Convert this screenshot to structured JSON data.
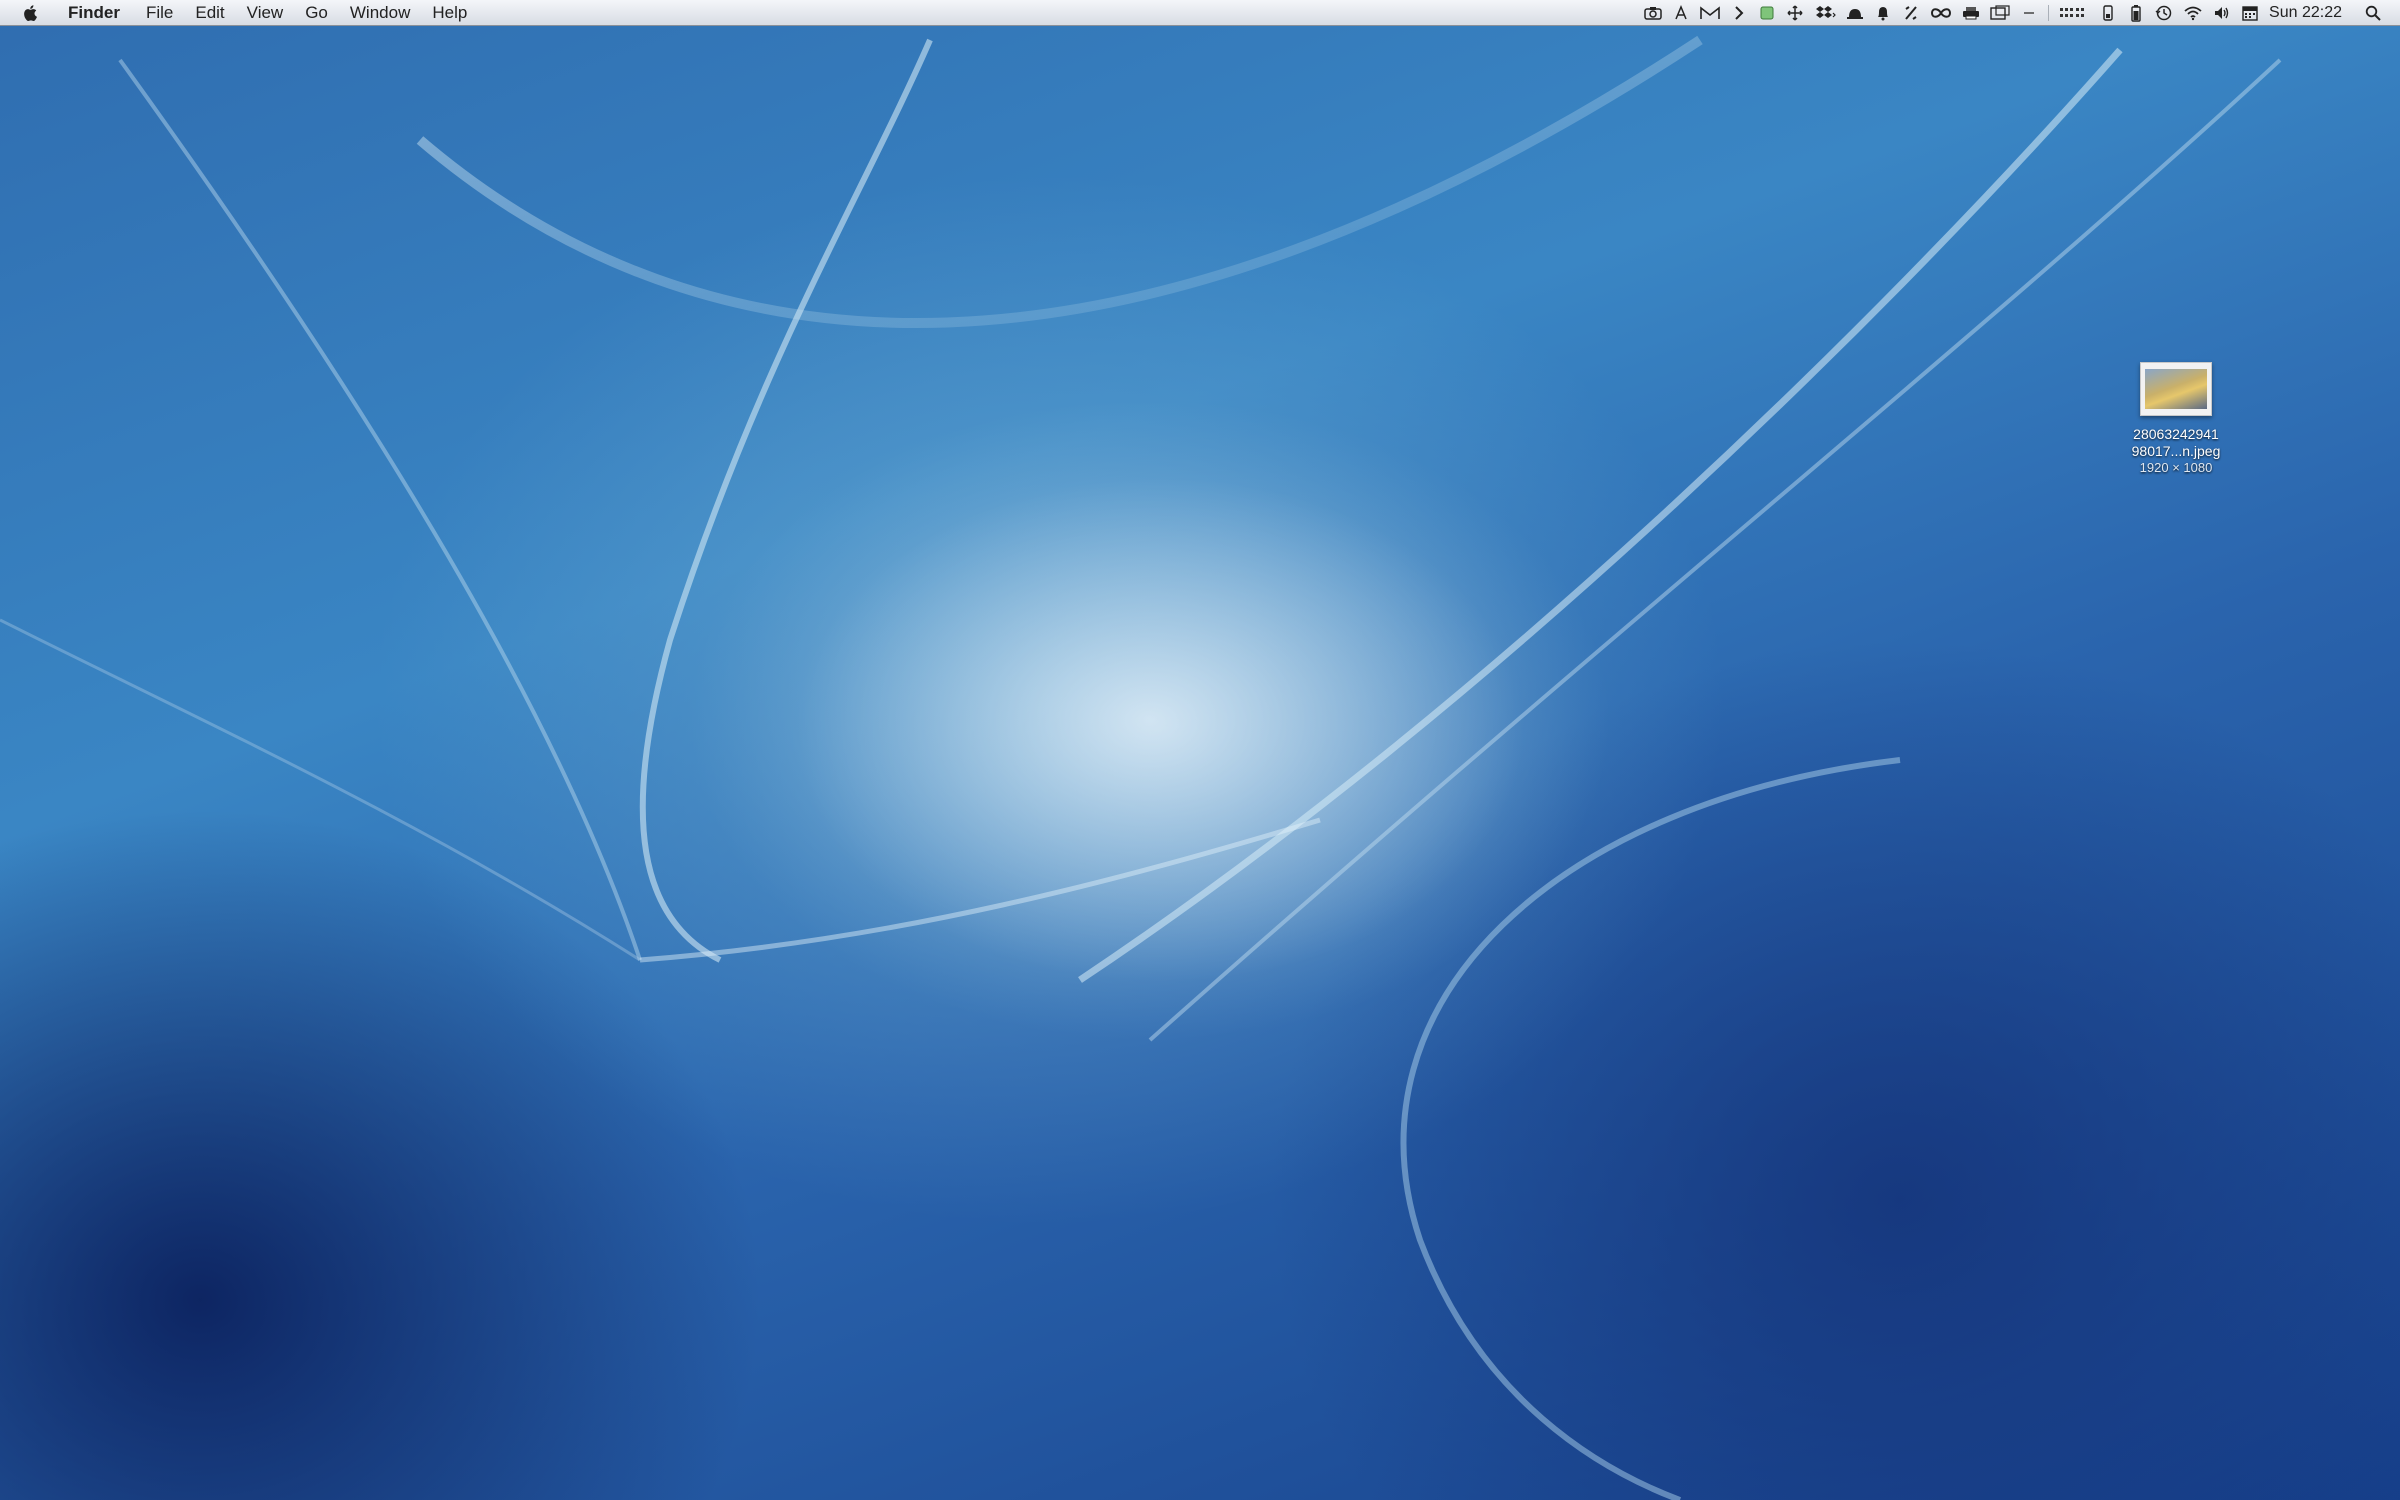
{
  "menubar": {
    "apple_icon": "apple-icon",
    "app_name": "Finder",
    "items": [
      {
        "label": "File"
      },
      {
        "label": "Edit"
      },
      {
        "label": "View"
      },
      {
        "label": "Go"
      },
      {
        "label": "Window"
      },
      {
        "label": "Help"
      }
    ],
    "status_icons": [
      "camera-icon",
      "script-icon",
      "gmail-icon",
      "chevron-icon",
      "finder-status-icon",
      "move-icon",
      "dropbox-icon",
      "bell-hat-icon",
      "bell-icon",
      "tools-icon",
      "infinity-icon",
      "printer-icon",
      "window-icon",
      "minus-icon",
      "grid-icon",
      "battery-icon",
      "time-machine-icon",
      "wifi-icon",
      "volume-icon",
      "calendar-icon"
    ],
    "clock": "Sun 22:22",
    "spotlight_icon": "search-icon"
  },
  "desktop": {
    "files": [
      {
        "name_line1": "28063242941",
        "name_line2": "98017...n.jpeg",
        "dimensions": "1920 × 1080"
      }
    ]
  }
}
